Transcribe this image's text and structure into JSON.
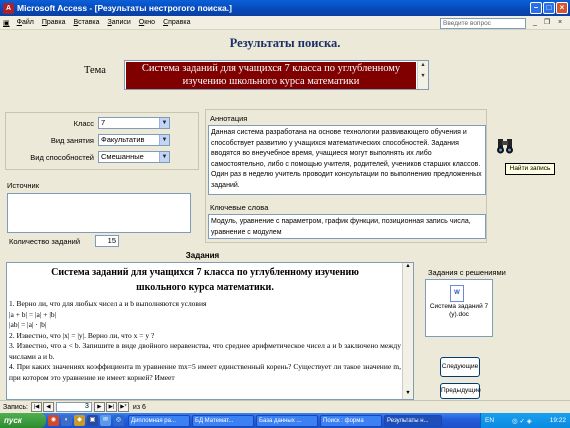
{
  "window": {
    "title": "Microsoft Access - [Результаты нестрогого поиска.]"
  },
  "menu": {
    "items": [
      "Файл",
      "Правка",
      "Вставка",
      "Записи",
      "Окно",
      "Справка"
    ],
    "help_placeholder": "Введите вопрос"
  },
  "form": {
    "heading": "Результаты поиска.",
    "tema_label": "Тема",
    "tema_value": "Система заданий для учащихся 7 класса по углубленному изучению школьного курса математики",
    "klass_label": "Класс",
    "klass_value": "7",
    "vid_zan_label": "Вид занятия",
    "vid_zan_value": "Факультатив",
    "vid_sposob_label": "Вид способностей",
    "vid_sposob_value": "Смешанные",
    "istochnik_label": "Источник",
    "istochnik_value": "",
    "kol_label": "Количество заданий",
    "kol_value": "15",
    "annotation_label": "Аннотация",
    "annotation_value": "Данная система разработана на основе технологии развивающего обучения и способствует развитию у учащихся математических способностей. Задания вводятся во внеучебное время, учащиеся могут выполнять их либо самостоятельно, либо с помощью учителя, родителей, учеников старших классов. Один раз в неделю учитель проводит консультации по выполнению предложенных заданий.",
    "keywords_label": "Ключевые слова",
    "keywords_value": "Модуль, уравнение с параметром, график функции, позиционная запись числа, уравнение с модулем",
    "find_tooltip": "Найти запись",
    "zadaniya_label": "Задания",
    "zadaniya": {
      "title_line1": "Система заданий для учащихся 7 класса по углубленному изучению",
      "title_line2": "школьного курса математики.",
      "item1": "1. Верно ли, что для любых чисел a и b выполняются условия",
      "eq1": "|a + b| = |a| + |b|",
      "eq2": "|ab| = |a| · |b|",
      "item2": "2. Известно, что |x| = |y|. Верно ли, что x = y ?",
      "item3": "3. Известно, что a < b. Запишите в виде двойного неравенства, что среднее арифметическое чисел a и b заключено между числами a и b.",
      "item4": "4. При каких значениях коэффициента m уравнение mx=5 имеет единственный корень? Существует ли такое значение m, при котором это уравнение не имеет корней? Имеет"
    },
    "solutions_label": "Задания с решениями",
    "solution_file": "Система заданий 7 (у).doc",
    "next_button": "Следующие",
    "prev_button": "Предыдущие"
  },
  "record_nav": {
    "label": "Запись:",
    "current": "3",
    "of_label": "из 6"
  },
  "taskbar": {
    "start": "пуск",
    "buttons": [
      "Дипломная ра...",
      "БД Математ...",
      "База данных ...",
      "Поиск : форма",
      "Результаты н..."
    ],
    "lang": "EN",
    "time": "19:22"
  }
}
